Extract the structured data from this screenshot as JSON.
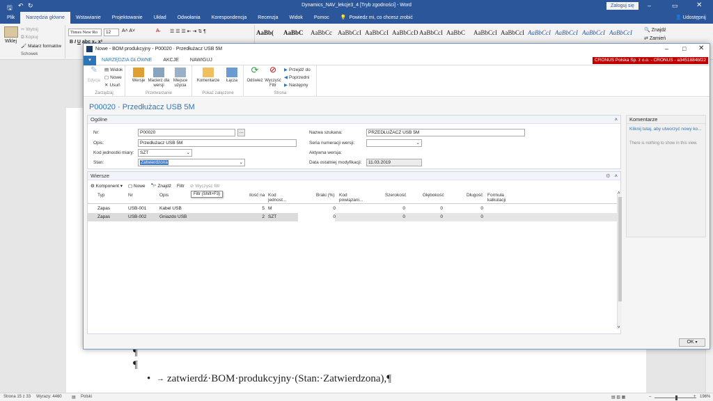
{
  "word": {
    "title": "Dynamics_NAV_lekcje3_4 [Tryb zgodności] - Word",
    "login": "Zaloguj się",
    "tabs": [
      "Plik",
      "Narzędzia główne",
      "Wstawianie",
      "Projektowanie",
      "Układ",
      "Odwołania",
      "Korespondencja",
      "Recenzja",
      "Widok",
      "Pomoc"
    ],
    "tell_me": "Powiedz mi, co chcesz zrobić",
    "share": "Udostępnij",
    "clipboard": {
      "paste": "Wklej",
      "cut": "Wytnij",
      "copy": "Kopiuj",
      "format_painter": "Malarz formatów",
      "group": "Schowek"
    },
    "font_name": "Times New Ro",
    "font_size": "12",
    "styles": [
      "AaBb(",
      "AaBbC",
      "AaBbCc",
      "AaBbCcI",
      "AaBbCcI",
      "AaBbCcD",
      "AaBbCcI",
      "AaBbC",
      "AaBbCcI",
      "AaBbCcI",
      "AaBbCcI",
      "AaBbCcI",
      "AaBbCcI",
      "AaBbCcI"
    ],
    "editing": {
      "find": "Znajdź",
      "replace": "Zamień"
    },
    "doc_lines": [
      "¶",
      "¶",
      "zatwierdź·BOM·produkcyjny·(Stan:·Zatwierdzona),¶"
    ],
    "status": {
      "page": "Strona 15 z 33",
      "words": "Wyrazy: 4460",
      "lang": "Polski",
      "zoom": "196%"
    }
  },
  "dialog": {
    "title": "Nowe - BOM produkcyjny - P00020 · Przedłużacz USB 5M",
    "tabs": [
      "NARZĘDZIA GŁÓWNE",
      "AKCJE",
      "NAWIGUJ"
    ],
    "company": "CRONUS Polska Sp. z o.o. - CRONUS - a3451884bf22",
    "ribbon": {
      "edit": "Edycja",
      "view": "Widok",
      "new": "Nowe",
      "delete": "Usuń",
      "manage": "Zarządzaj",
      "versions": "Wersje",
      "matrix": "Macierz dla wersji",
      "where_used": "Miejsce użycia",
      "processing": "Przetwarzanie",
      "comments": "Komentarze",
      "links": "Łącza",
      "show_attached": "Pokaż załączone",
      "refresh": "Odśwież",
      "clear_filter": "Wyczyść Filtr",
      "goto": "Przejdź do",
      "previous": "Poprzedni",
      "next": "Następny",
      "page": "Strona"
    },
    "heading": "P00020 · Przedłużacz USB 5M",
    "general": {
      "title": "Ogólne",
      "nr_label": "Nr:",
      "nr": "P00020",
      "desc_label": "Opis:",
      "desc": "Przedłużacz USB 5M",
      "uom_label": "Kod jednostki miary:",
      "uom": "SZT",
      "status_label": "Stan:",
      "status": "Zatwierdzona",
      "search_label": "Nazwa szukana:",
      "search": "PRZEDŁUŻACZ USB 5M",
      "series_label": "Seria numeracji wersji:",
      "active_label": "Aktywna wersja:",
      "modified_label": "Data ostatniej modyfikacji:",
      "modified": "11.03.2019"
    },
    "lines": {
      "title": "Wiersze",
      "toolbar": [
        "Komponent",
        "Nowe",
        "Znajdź",
        "Filtr",
        "Wyczyść filtr"
      ],
      "tooltip": "Filtr (Shift+F3)",
      "columns": [
        "Typ",
        "Nr",
        "Opis",
        "Ilość na",
        "Kod jednost...",
        "Braki (%)",
        "Kod powiązani...",
        "Szerokość",
        "Głębokość",
        "Długość",
        "Formuła kalkulacji"
      ],
      "rows": [
        [
          "Zapas",
          "USB-001",
          "Kabel USB",
          "5",
          "M",
          "0",
          "",
          "0",
          "0",
          "0",
          ""
        ],
        [
          "Zapas",
          "USB-002",
          "Gniazdo USB",
          "2",
          "SZT",
          "0",
          "",
          "0",
          "0",
          "0",
          ""
        ]
      ]
    },
    "comments": {
      "title": "Komentarze",
      "link": "Kliknij tutaj, aby utworzyć nowy ko...",
      "empty": "There is nothing to show in this view."
    },
    "ok": "OK"
  },
  "colors": {
    "word_blue": "#2b579a",
    "nav_blue": "#2e75b6",
    "company_red": "#c00000"
  }
}
